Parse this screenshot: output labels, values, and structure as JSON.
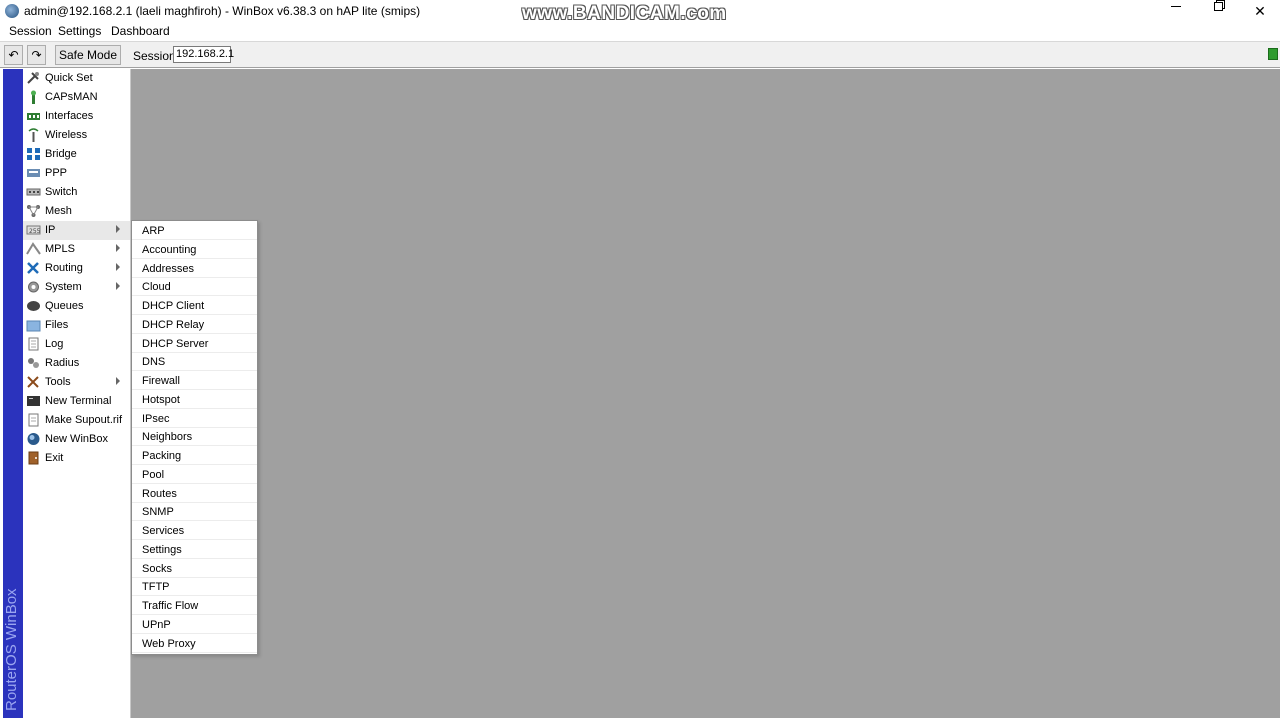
{
  "window": {
    "title": "admin@192.168.2.1 (laeli maghfiroh) - WinBox v6.38.3 on hAP lite (smips)",
    "watermark": "www.BANDICAM.com",
    "close_glyph": "✕"
  },
  "menubar": {
    "items": [
      "Session",
      "Settings",
      "Dashboard"
    ]
  },
  "toolbar": {
    "undo_glyph": "↶",
    "redo_glyph": "↷",
    "safe_mode_label": "Safe Mode",
    "session_label": "Session:",
    "session_value": "192.168.2.1",
    "status_color": "#2d9b2d"
  },
  "side_banner": {
    "text": "RouterOS WinBox"
  },
  "left_menu": {
    "items": [
      {
        "label": "Quick Set",
        "icon": "quick-set-icon",
        "submenu": false
      },
      {
        "label": "CAPsMAN",
        "icon": "capsman-icon",
        "submenu": false
      },
      {
        "label": "Interfaces",
        "icon": "interfaces-icon",
        "submenu": false
      },
      {
        "label": "Wireless",
        "icon": "wireless-icon",
        "submenu": false
      },
      {
        "label": "Bridge",
        "icon": "bridge-icon",
        "submenu": false
      },
      {
        "label": "PPP",
        "icon": "ppp-icon",
        "submenu": false
      },
      {
        "label": "Switch",
        "icon": "switch-icon",
        "submenu": false
      },
      {
        "label": "Mesh",
        "icon": "mesh-icon",
        "submenu": false
      },
      {
        "label": "IP",
        "icon": "ip-icon",
        "submenu": true
      },
      {
        "label": "MPLS",
        "icon": "mpls-icon",
        "submenu": true
      },
      {
        "label": "Routing",
        "icon": "routing-icon",
        "submenu": true
      },
      {
        "label": "System",
        "icon": "system-gear-icon",
        "submenu": true
      },
      {
        "label": "Queues",
        "icon": "queues-icon",
        "submenu": false
      },
      {
        "label": "Files",
        "icon": "folder-icon",
        "submenu": false
      },
      {
        "label": "Log",
        "icon": "log-icon",
        "submenu": false
      },
      {
        "label": "Radius",
        "icon": "radius-icon",
        "submenu": false
      },
      {
        "label": "Tools",
        "icon": "tools-icon",
        "submenu": true
      },
      {
        "label": "New Terminal",
        "icon": "terminal-icon",
        "submenu": false
      },
      {
        "label": "Make Supout.rif",
        "icon": "supout-icon",
        "submenu": false
      },
      {
        "label": "New WinBox",
        "icon": "winbox-icon",
        "submenu": false
      },
      {
        "label": "Exit",
        "icon": "exit-icon",
        "submenu": false
      }
    ]
  },
  "ip_submenu": {
    "items": [
      "ARP",
      "Accounting",
      "Addresses",
      "Cloud",
      "DHCP Client",
      "DHCP Relay",
      "DHCP Server",
      "DNS",
      "Firewall",
      "Hotspot",
      "IPsec",
      "Neighbors",
      "Packing",
      "Pool",
      "Routes",
      "SNMP",
      "Services",
      "Settings",
      "Socks",
      "TFTP",
      "Traffic Flow",
      "UPnP",
      "Web Proxy"
    ]
  }
}
